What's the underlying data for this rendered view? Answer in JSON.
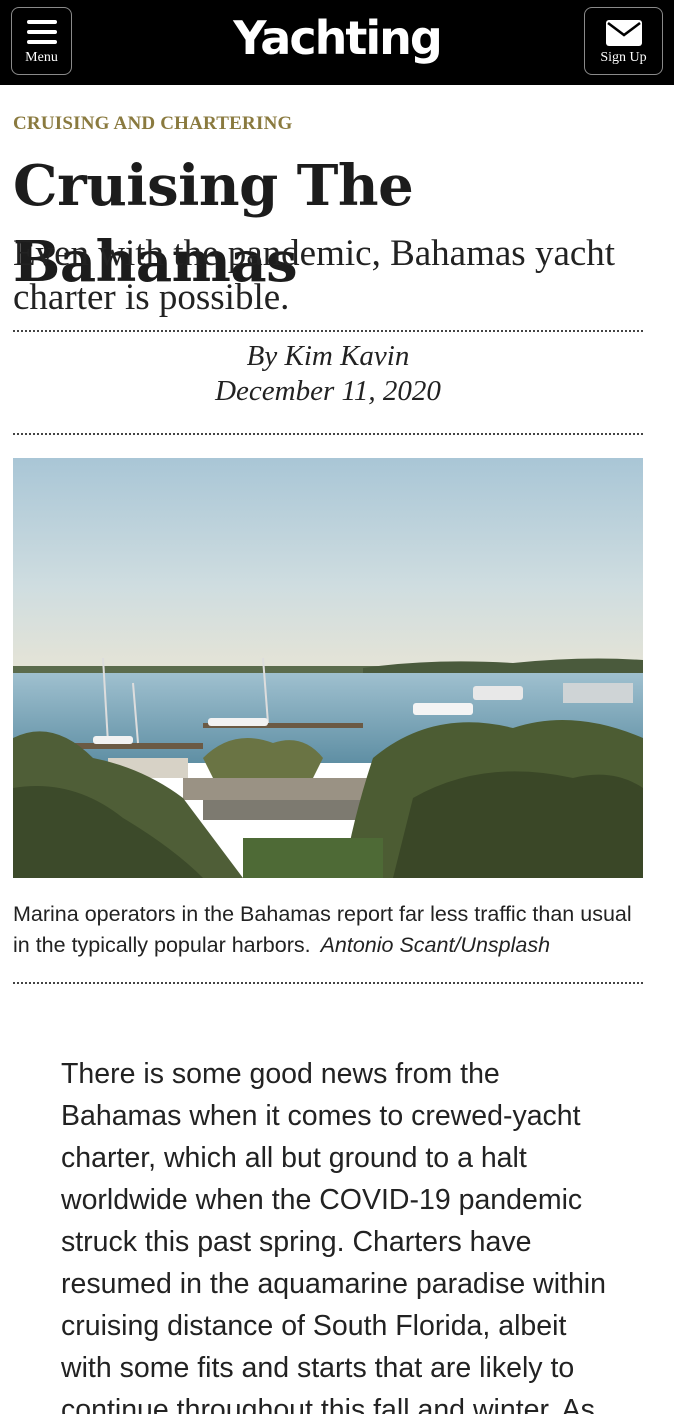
{
  "header": {
    "menu_label": "Menu",
    "logo_text": "Yachting",
    "signup_label": "Sign Up",
    "background": "#000000"
  },
  "article": {
    "kicker": "CRUISING AND CHARTERING",
    "kicker_color": "#8a7a3f",
    "title": "Cruising The Bahamas",
    "subtitle": "Even with the pandemic, Bahamas yacht charter is possible.",
    "author": "By Kim Kavin",
    "date": "December 11, 2020",
    "image": {
      "caption": "Marina operators in the Bahamas report far less traffic than usual in the typically popular harbors.",
      "credit": "Antonio Scant/Unsplash"
    },
    "body": "There is some good news from the Bahamas when it comes to crewed-yacht charter, which all but ground to a halt worldwide when the COVID-19 pandemic struck this past spring. Charters have resumed in the aquamarine paradise within cruising distance of South Florida, albeit with some fits and starts that are likely to continue throughout this fall and winter. As"
  }
}
